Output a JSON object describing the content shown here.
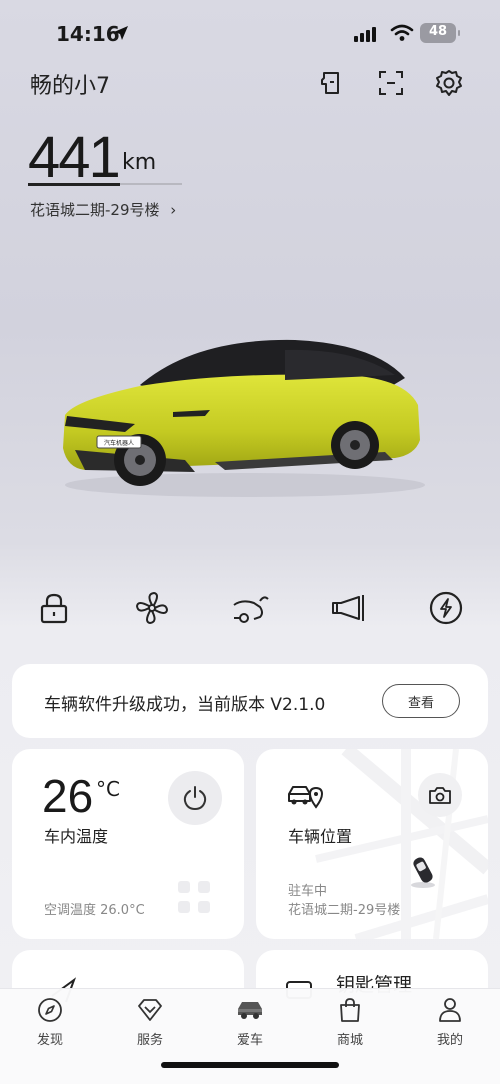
{
  "status_bar": {
    "time": "14:16",
    "battery": "48"
  },
  "header": {
    "car_name": "畅的小7",
    "icons": [
      "car-door-icon",
      "scan-icon",
      "settings-icon"
    ]
  },
  "range": {
    "value": "441",
    "unit": "km",
    "fill_fraction": 0.6
  },
  "location_line": {
    "address": "花语城二期-29号楼",
    "chevron": "›"
  },
  "plate_text": "汽车机器人",
  "quick_controls": [
    "lock-icon",
    "fan-icon",
    "trunk-icon",
    "horn-icon",
    "charge-icon"
  ],
  "update_banner": {
    "text": "车辆软件升级成功，当前版本 V2.1.0",
    "button": "查看"
  },
  "climate_card": {
    "temperature": "26",
    "unit": "°C",
    "label": "车内温度",
    "sub": "空调温度 26.0°C"
  },
  "location_card": {
    "label": "车辆位置",
    "status": "驻车中",
    "address": "花语城二期-29号楼"
  },
  "partial_cards": {
    "right_title": "钥匙管理"
  },
  "tab_bar": {
    "tabs": [
      {
        "label": "发现",
        "icon": "compass-icon"
      },
      {
        "label": "服务",
        "icon": "diamond-icon"
      },
      {
        "label": "爱车",
        "icon": "car-icon",
        "active": true
      },
      {
        "label": "商城",
        "icon": "bag-icon"
      },
      {
        "label": "我的",
        "icon": "person-icon"
      }
    ]
  },
  "colors": {
    "car_body": "#c8cf2a",
    "text": "#1a1a1a",
    "muted": "#888888"
  }
}
